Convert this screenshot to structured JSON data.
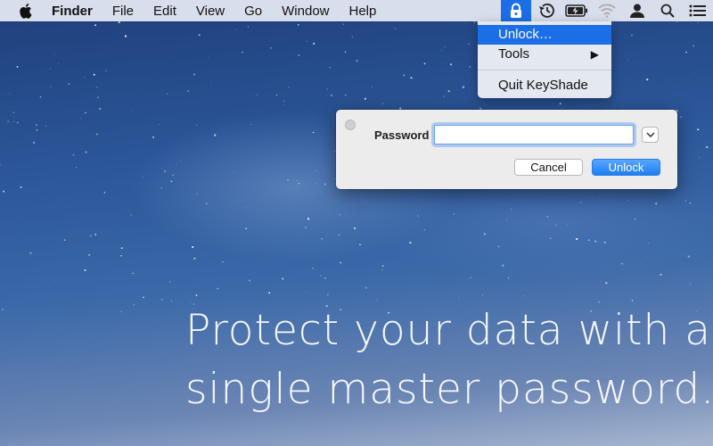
{
  "menubar": {
    "app_name": "Finder",
    "items": [
      "File",
      "Edit",
      "View",
      "Go",
      "Window",
      "Help"
    ],
    "status_icons": [
      "lock-icon",
      "time-machine-icon",
      "battery-charging-icon",
      "wifi-icon",
      "user-icon",
      "spotlight-icon",
      "notification-center-icon"
    ]
  },
  "dropdown": {
    "items": [
      {
        "label": "Unlock…",
        "highlighted": true
      },
      {
        "label": "Tools",
        "has_submenu": true
      },
      {
        "label": "Quit KeyShade"
      }
    ]
  },
  "dialog": {
    "password_label": "Password",
    "password_value": "",
    "cancel_label": "Cancel",
    "unlock_label": "Unlock"
  },
  "tagline": {
    "line1": "Protect your data with a",
    "line2": "single master password."
  },
  "colors": {
    "accent": "#1c6ee6",
    "menubar": "#e8ecf4",
    "dialog": "#ececec"
  }
}
